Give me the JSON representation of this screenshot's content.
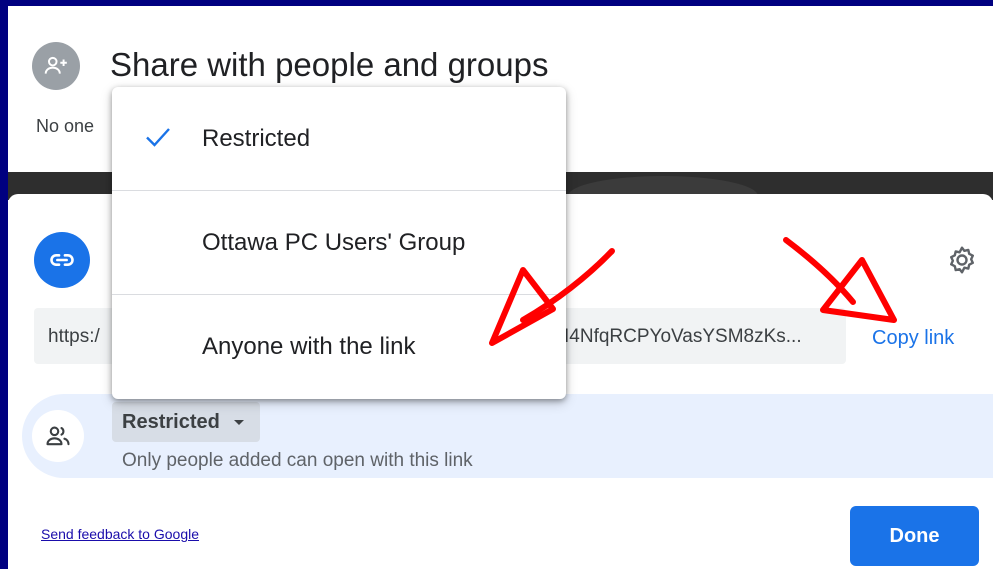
{
  "dialog": {
    "title": "Share with people and groups",
    "no_one_text": "No one"
  },
  "link": {
    "url_prefix": "https:/",
    "url_end": "I4NfqRCPYoVasYSM8zKs...",
    "copy_label": "Copy link"
  },
  "general_access": {
    "selected": "Restricted",
    "description": "Only people added can open with this link"
  },
  "dropdown": {
    "options": [
      {
        "label": "Restricted",
        "checked": true
      },
      {
        "label": "Ottawa PC Users' Group",
        "checked": false
      },
      {
        "label": "Anyone with the link",
        "checked": false
      }
    ]
  },
  "footer": {
    "feedback_label": "Send feedback to Google",
    "done_label": "Done"
  },
  "colors": {
    "accent": "#1a73e8",
    "border": "#000080",
    "annotation": "#ff0000"
  }
}
